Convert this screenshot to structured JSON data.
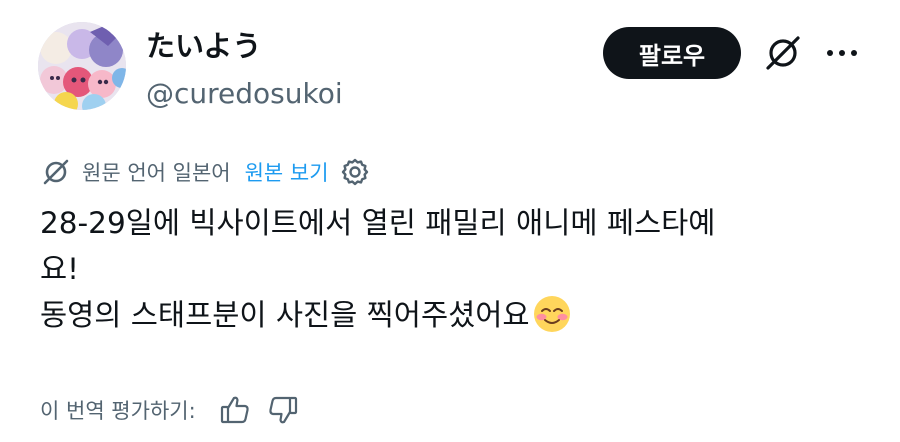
{
  "header": {
    "display_name": "たいよう",
    "username": "@curedosukoi",
    "follow_label": "팔로우"
  },
  "translation": {
    "label": "원문 언어 일본어",
    "view_original": "원본 보기"
  },
  "tweet": {
    "lines": [
      "28-29일에 빅사이트에서 열린 패밀리 애니메 페스타예",
      "요!",
      "동영의 스태프분이 사진을 찍어주셨어요"
    ],
    "emoji": "smiling-blushing-face"
  },
  "rating": {
    "label": "이 번역 평가하기:"
  },
  "icons": {
    "grok": "grok-icon",
    "more": "more-icon",
    "translate": "grok-translate-icon",
    "settings": "gear-icon",
    "thumbs_up": "thumbs-up-icon",
    "thumbs_down": "thumbs-down-icon"
  },
  "colors": {
    "text": "#0f1419",
    "secondary": "#536471",
    "link": "#1d9bf0",
    "button": "#0f1419"
  }
}
